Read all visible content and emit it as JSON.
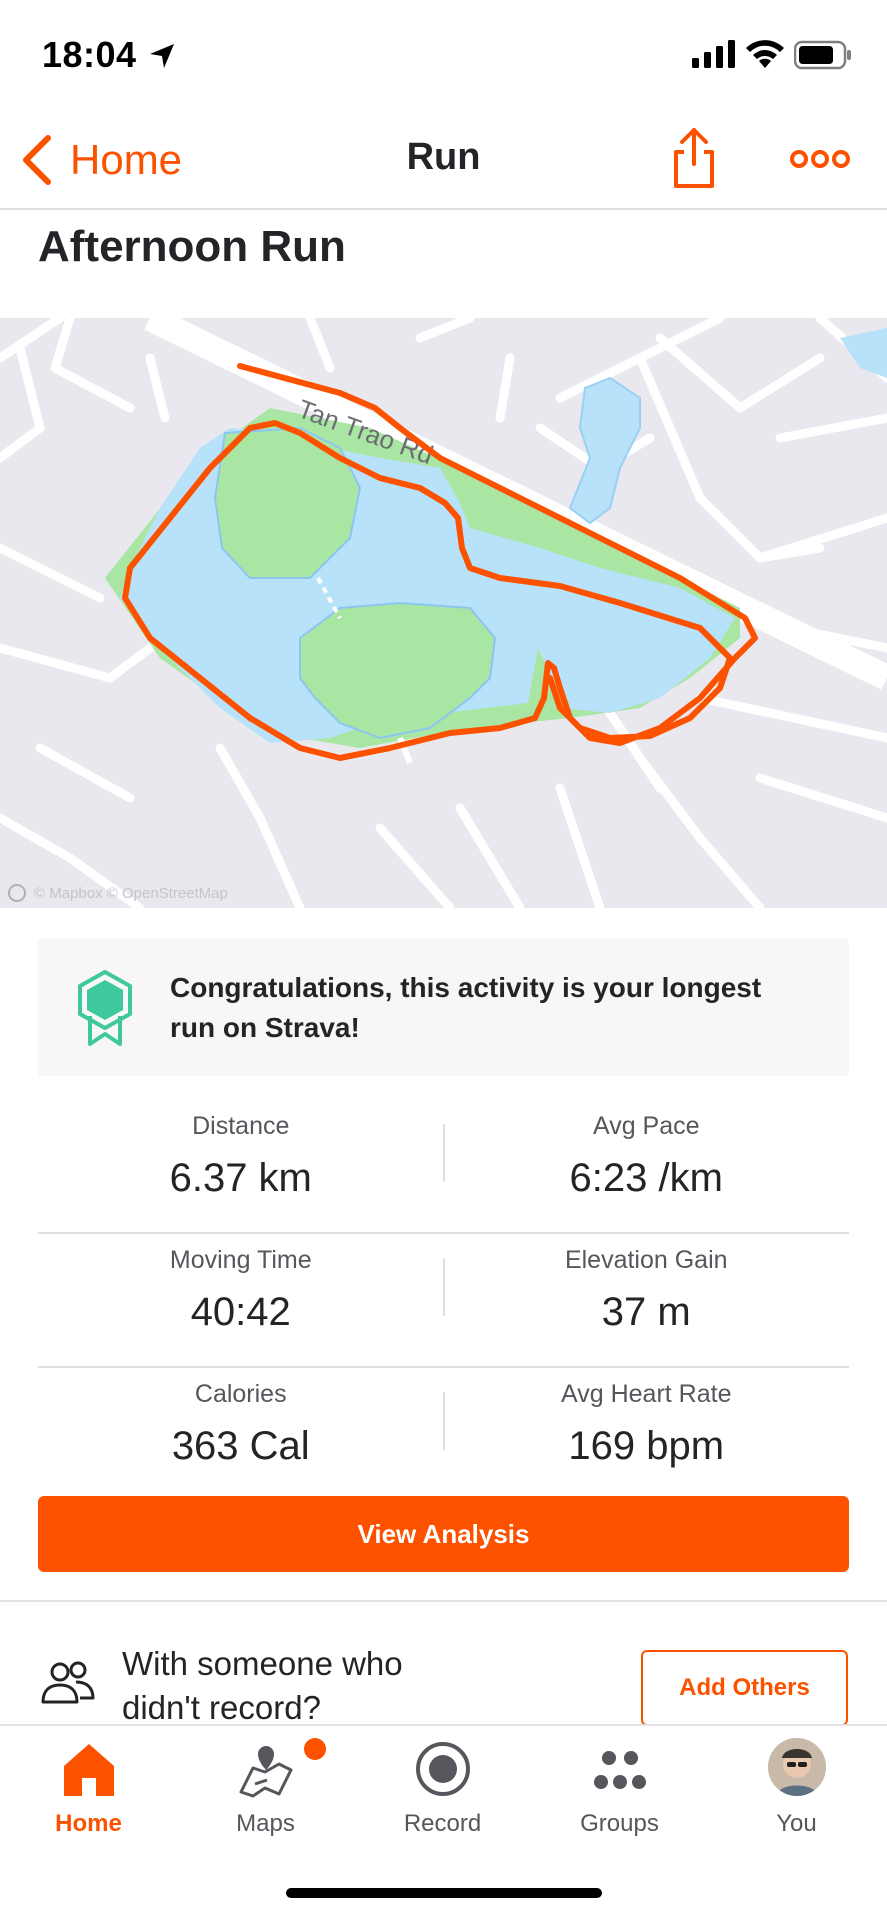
{
  "status_bar": {
    "time": "18:04"
  },
  "nav": {
    "back_label": "Home",
    "title": "Run"
  },
  "activity": {
    "title": "Afternoon Run"
  },
  "map": {
    "road_label": "Tan Trao Rd",
    "attribution": "© Mapbox © OpenStreetMap",
    "route_color": "#fc5200",
    "water_color": "#b8e1fa",
    "park_color": "#a9e6a4"
  },
  "achievement": {
    "text": "Congratulations, this activity is your longest run on Strava!",
    "icon_color": "#3fc79d"
  },
  "stats": [
    {
      "left": {
        "label": "Distance",
        "value": "6.37 km"
      },
      "right": {
        "label": "Avg Pace",
        "value": "6:23 /km"
      }
    },
    {
      "left": {
        "label": "Moving Time",
        "value": "40:42"
      },
      "right": {
        "label": "Elevation Gain",
        "value": "37 m"
      }
    },
    {
      "left": {
        "label": "Calories",
        "value": "363 Cal"
      },
      "right": {
        "label": "Avg Heart Rate",
        "value": "169 bpm"
      }
    }
  ],
  "view_analysis_label": "View Analysis",
  "with_someone": {
    "text": "With someone who didn't record?",
    "button_label": "Add Others"
  },
  "tabs": [
    {
      "label": "Home",
      "icon": "home-icon",
      "active": true
    },
    {
      "label": "Maps",
      "icon": "maps-icon",
      "active": false
    },
    {
      "label": "Record",
      "icon": "record-icon",
      "active": false
    },
    {
      "label": "Groups",
      "icon": "groups-icon",
      "active": false
    },
    {
      "label": "You",
      "icon": "avatar",
      "active": false
    }
  ],
  "accent_color": "#fc5200"
}
